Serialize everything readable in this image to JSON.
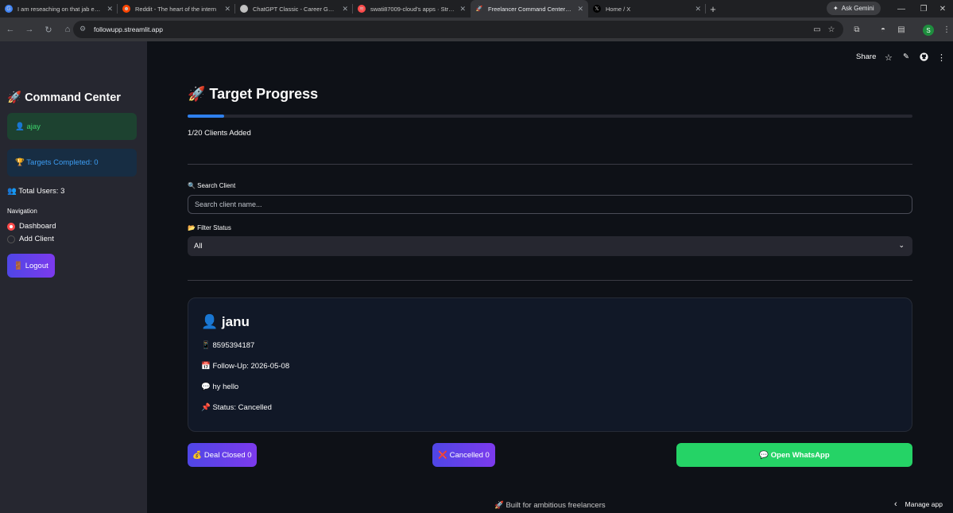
{
  "browser": {
    "tabs": [
      {
        "title": "I am reseaching on that jab ek p",
        "fav_color": "#4285f4",
        "fav_glyph": "G"
      },
      {
        "title": "Reddit - The heart of the intern",
        "fav_color": "#ff4500",
        "fav_glyph": "☻"
      },
      {
        "title": "ChatGPT Classic - Career Guida",
        "fav_color": "#bfbfbf",
        "fav_glyph": "✿"
      },
      {
        "title": "swati87009-cloud's apps · Strea",
        "fav_color": "#ff4b4b",
        "fav_glyph": "≋"
      },
      {
        "title": "Freelancer Command Center - S",
        "fav_color": "#35363a",
        "fav_glyph": "🚀"
      },
      {
        "title": "Home / X",
        "fav_color": "#000000",
        "fav_glyph": "𝕏"
      }
    ],
    "gemini_label": "Ask Gemini",
    "url": "followupp.streamlit.app",
    "profile_initial": "S"
  },
  "sidebar": {
    "title": "🚀 Command Center",
    "user": "👤 ajay",
    "targets": "🏆 Targets Completed: 0",
    "total_users": "👥 Total Users: 3",
    "nav_label": "Navigation",
    "nav_options": [
      "Dashboard",
      "Add Client"
    ],
    "nav_selected": "Dashboard",
    "logout": "🚪 Logout"
  },
  "topbar": {
    "share": "Share"
  },
  "main": {
    "title": "🚀 Target Progress",
    "progress_fraction": 0.05,
    "progress_label": "1/20 Clients Added",
    "search_label": "🔍 Search Client",
    "search_placeholder": "Search client name...",
    "filter_label": "📂 Filter Status",
    "filter_value": "All"
  },
  "client_card": {
    "name": "👤 janu",
    "phone": "📱 8595394187",
    "followup": "📅 Follow-Up: 2026-05-08",
    "note": "💬 hy hello",
    "status": "📌 Status: Cancelled"
  },
  "actions": {
    "deal_closed": "💰 Deal Closed 0",
    "cancelled": "❌ Cancelled 0",
    "whatsapp": "💬 Open WhatsApp"
  },
  "footer": {
    "text": "🚀 Built for ambitious freelancers",
    "manage": "Manage app"
  }
}
